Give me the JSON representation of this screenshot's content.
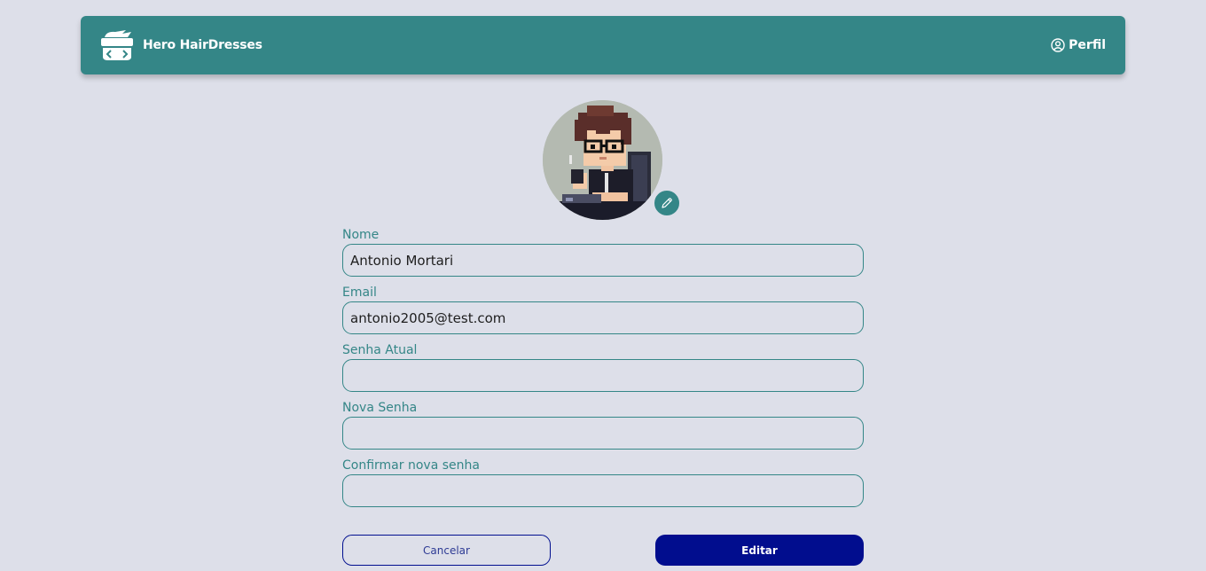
{
  "header": {
    "brand_name": "Hero HairDresses",
    "logo_icon": "hero-mask-code-icon",
    "profile_label": "Perfil",
    "profile_icon": "user-circle-icon"
  },
  "profile": {
    "avatar_alt": "Pixel art avatar",
    "edit_avatar_icon": "pencil-icon"
  },
  "form": {
    "name_label": "Nome",
    "name_value": "Antonio Mortari",
    "email_label": "Email",
    "email_value": "antonio2005@test.com",
    "current_password_label": "Senha Atual",
    "current_password_value": "",
    "new_password_label": "Nova Senha",
    "new_password_value": "",
    "confirm_password_label": "Confirmar nova senha",
    "confirm_password_value": ""
  },
  "actions": {
    "cancel_label": "Cancelar",
    "edit_label": "Editar"
  },
  "colors": {
    "primary_teal": "#348687",
    "background": "#dddfe9",
    "button_navy": "#010d8e"
  }
}
